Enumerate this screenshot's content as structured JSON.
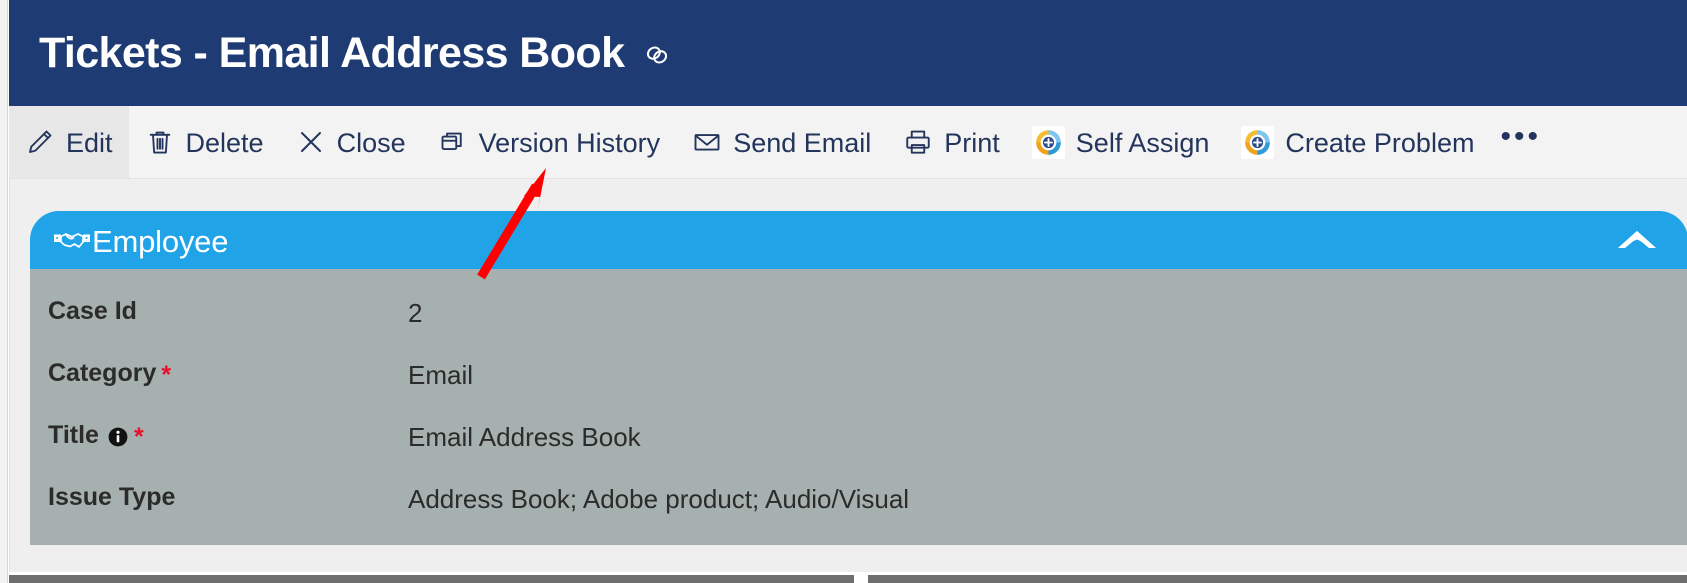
{
  "window": {
    "title": "Tickets - Email Address Book",
    "title_icon": "link-icon",
    "title_bar_color": "#1f3b73"
  },
  "toolbar": {
    "items": [
      {
        "label": "Edit",
        "icon": "pencil-icon",
        "selected": true
      },
      {
        "label": "Delete",
        "icon": "trash-icon",
        "selected": false
      },
      {
        "label": "Close",
        "icon": "close-x-icon",
        "selected": false
      },
      {
        "label": "Version History",
        "icon": "copy-stack-icon",
        "selected": false
      },
      {
        "label": "Send Email",
        "icon": "envelope-icon",
        "selected": false
      },
      {
        "label": "Print",
        "icon": "printer-icon",
        "selected": false
      },
      {
        "label": "Self Assign",
        "icon": "refresh-plus-icon",
        "selected": false
      },
      {
        "label": "Create Problem",
        "icon": "refresh-plus-icon",
        "selected": false
      }
    ],
    "overflow_label": "•••",
    "background": "#f3f3f3"
  },
  "section": {
    "title": "Employee",
    "icon": "handshake-icon",
    "collapse_icon": "chevron-up-icon",
    "header_color": "#21a3e8",
    "panel_color": "#a6b0ae"
  },
  "form": {
    "rows": [
      {
        "label": "Case Id",
        "required": false,
        "info": false,
        "value": "2"
      },
      {
        "label": "Category",
        "required": true,
        "info": false,
        "value": "Email"
      },
      {
        "label": "Title",
        "required": true,
        "info": true,
        "value": "Email Address Book"
      },
      {
        "label": "Issue Type",
        "required": false,
        "info": false,
        "value": "Address Book; Adobe product; Audio/Visual"
      }
    ],
    "required_marker": "*",
    "required_color": "#e8102a"
  },
  "annotation": {
    "type": "arrow",
    "color": "#fe0000",
    "points_at": "Version History"
  }
}
